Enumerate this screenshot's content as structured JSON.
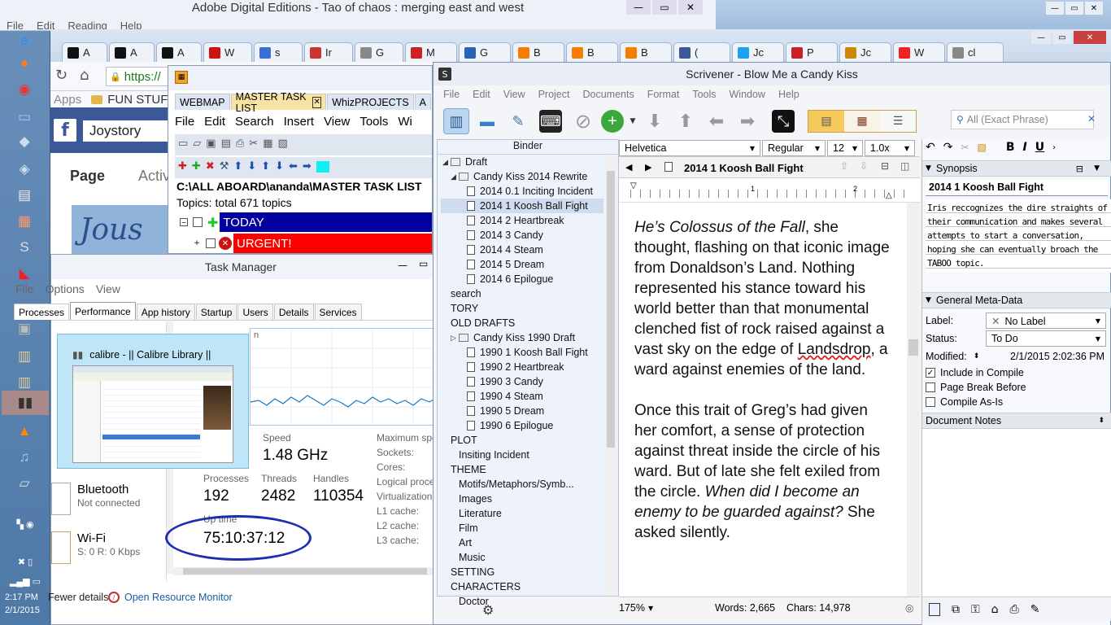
{
  "taskbar": {
    "time": "2:17 PM",
    "date": "2/1/2015"
  },
  "ade": {
    "title": "Adobe Digital Editions - Tao of chaos : merging east and west",
    "menu": [
      "File",
      "Edit",
      "Reading",
      "Help"
    ]
  },
  "chrome": {
    "tabs": [
      {
        "label": "A",
        "icon": "amazon",
        "color": "#111"
      },
      {
        "label": "A",
        "icon": "amazon",
        "color": "#111"
      },
      {
        "label": "A",
        "icon": "amazon",
        "color": "#111"
      },
      {
        "label": "W",
        "icon": "netflix",
        "color": "#c11"
      },
      {
        "label": "s",
        "icon": "google",
        "color": "#3a6fd8"
      },
      {
        "label": "Ir",
        "icon": "gmail",
        "color": "#c33"
      },
      {
        "label": "G",
        "icon": "doc",
        "color": "#888"
      },
      {
        "label": "M",
        "icon": "play",
        "color": "#c22"
      },
      {
        "label": "G",
        "icon": "one",
        "color": "#2a62b8"
      },
      {
        "label": "B",
        "icon": "blogger",
        "color": "#f57d00"
      },
      {
        "label": "B",
        "icon": "blogger",
        "color": "#f57d00"
      },
      {
        "label": "B",
        "icon": "blogger",
        "color": "#f57d00"
      },
      {
        "label": "(",
        "icon": "facebook",
        "color": "#3b5998"
      },
      {
        "label": "Jc",
        "icon": "twitter",
        "color": "#1da1f2"
      },
      {
        "label": "P",
        "icon": "pinterest",
        "color": "#cb2027"
      },
      {
        "label": "Jc",
        "icon": "burger",
        "color": "#c80"
      },
      {
        "label": "W",
        "icon": "youtube",
        "color": "#e22"
      },
      {
        "label": "cl",
        "icon": "doc",
        "color": "#888"
      }
    ],
    "address": "https://",
    "bookmark": "FUN STUFF",
    "apps_label": "Apps"
  },
  "facebook": {
    "search_value": "Joystory",
    "nav_page": "Page",
    "nav_activity": "Activ",
    "banner_text": "Jous"
  },
  "whiz": {
    "tabs": [
      "WEBMAP",
      "MASTER TASK LIST",
      "WhizPROJECTS",
      "A"
    ],
    "menu": [
      "File",
      "Edit",
      "Search",
      "Insert",
      "View",
      "Tools",
      "Wi"
    ],
    "path": "C:\\ALL ABOARD\\ananda\\MASTER TASK LIST",
    "topics": "Topics: total 671 topics",
    "today": "TODAY",
    "urgent": "URGENT!"
  },
  "taskmgr": {
    "title": "Task Manager",
    "menu": [
      "File",
      "Options",
      "View"
    ],
    "tabs": [
      "Processes",
      "Performance",
      "App history",
      "Startup",
      "Users",
      "Details",
      "Services"
    ],
    "speed_label": "Speed",
    "speed": "1.48 GHz",
    "processes_label": "Processes",
    "processes": "192",
    "threads_label": "Threads",
    "threads": "2482",
    "handles_label": "Handles",
    "handles": "110354",
    "uptime_label": "Up time",
    "uptime": "75:10:37:12",
    "right_labels": [
      "Maximum speed:",
      "Sockets:",
      "Cores:",
      "Logical processors:",
      "Virtualization:",
      "L1 cache:",
      "L2 cache:",
      "L3 cache:"
    ],
    "bluetooth": "Bluetooth",
    "bluetooth_status": "Not connected",
    "wifi": "Wi-Fi",
    "wifi_status": "S: 0 R: 0 Kbps",
    "fewer": "Fewer details",
    "resmon": "Open Resource Monitor",
    "graph_label": "n"
  },
  "calibre": {
    "title": "calibre - || Calibre Library ||"
  },
  "scrivener": {
    "title": "Scrivener - Blow Me a Candy Kiss",
    "menu": [
      "File",
      "Edit",
      "View",
      "Project",
      "Documents",
      "Format",
      "Tools",
      "Window",
      "Help"
    ],
    "search_placeholder": "All (Exact Phrase)",
    "binder_label": "Binder",
    "binder": [
      {
        "label": "Draft",
        "level": 0,
        "type": "folder",
        "open": true
      },
      {
        "label": "Candy Kiss 2014 Rewrite",
        "level": 1,
        "type": "folder",
        "open": true
      },
      {
        "label": "2014 0.1 Inciting Incident",
        "level": 2,
        "type": "doc"
      },
      {
        "label": "2014 1 Koosh Ball Fight",
        "level": 2,
        "type": "doc",
        "selected": true
      },
      {
        "label": "2014 2 Heartbreak",
        "level": 2,
        "type": "doc"
      },
      {
        "label": "2014 3 Candy",
        "level": 2,
        "type": "doc"
      },
      {
        "label": "2014 4 Steam",
        "level": 2,
        "type": "doc"
      },
      {
        "label": "2014 5 Dream",
        "level": 2,
        "type": "doc"
      },
      {
        "label": "2014 6 Epilogue",
        "level": 2,
        "type": "doc"
      },
      {
        "label": "search",
        "level": 0,
        "type": "plain"
      },
      {
        "label": "TORY",
        "level": 0,
        "type": "plain"
      },
      {
        "label": "OLD DRAFTS",
        "level": 0,
        "type": "plain"
      },
      {
        "label": "Candy Kiss 1990 Draft",
        "level": 1,
        "type": "folder"
      },
      {
        "label": "1990 1 Koosh Ball Fight",
        "level": 2,
        "type": "doc"
      },
      {
        "label": "1990 2 Heartbreak",
        "level": 2,
        "type": "doc"
      },
      {
        "label": "1990 3 Candy",
        "level": 2,
        "type": "doc"
      },
      {
        "label": "1990 4 Steam",
        "level": 2,
        "type": "doc"
      },
      {
        "label": "1990 5 Dream",
        "level": 2,
        "type": "doc"
      },
      {
        "label": "1990 6 Epilogue",
        "level": 2,
        "type": "doc"
      },
      {
        "label": "PLOT",
        "level": 0,
        "type": "plain"
      },
      {
        "label": "Insiting Incident",
        "level": 1,
        "type": "plain"
      },
      {
        "label": "THEME",
        "level": 0,
        "type": "plain"
      },
      {
        "label": "Motifs/Metaphors/Symb...",
        "level": 1,
        "type": "plain"
      },
      {
        "label": "Images",
        "level": 1,
        "type": "plain"
      },
      {
        "label": "Literature",
        "level": 1,
        "type": "plain"
      },
      {
        "label": "Film",
        "level": 1,
        "type": "plain"
      },
      {
        "label": "Art",
        "level": 1,
        "type": "plain"
      },
      {
        "label": "Music",
        "level": 1,
        "type": "plain"
      },
      {
        "label": "SETTING",
        "level": 0,
        "type": "plain"
      },
      {
        "label": "CHARACTERS",
        "level": 0,
        "type": "plain"
      },
      {
        "label": "Doctor",
        "level": 1,
        "type": "plain"
      }
    ],
    "format": {
      "font": "Helvetica",
      "style": "Regular",
      "size": "12",
      "spacing": "1.0x"
    },
    "doc_title": "2014 1 Koosh Ball Fight",
    "text": {
      "p1_italic": "He’s Colossus of the Fall",
      "p1_rest": ", she thought, flashing on that iconic image from Donaldson’s Land. Nothing represented his stance toward his world better than that monumental clenched fist of rock raised against a vast sky on the edge of ",
      "p1_word": "Landsdrop",
      "p1_end": ", a ward against enemies of the land.",
      "p2": "Once this trait of Greg’s had given her comfort, a sense of protection against threat inside the circle of his ward. But of late she felt exiled from the circle. ",
      "p2_italic": "When did I become an enemy to be guarded against?",
      "p2_end": " She asked silently."
    },
    "ruler_marks": [
      "1",
      "2"
    ],
    "zoom": "175%",
    "words": "Words: 2,665",
    "chars": "Chars: 14,978",
    "inspector": {
      "synopsis_label": "Synopsis",
      "synopsis_title": "2014 1 Koosh Ball Fight",
      "synopsis": "Iris reccognizes the dire straights of their communication and makes several attempts to start a conversation, hoping she can eventually broach the TABOO topic.",
      "meta_label": "General Meta-Data",
      "label_label": "Label:",
      "label_value": "No Label",
      "status_label": "Status:",
      "status_value": "To Do",
      "modified_label": "Modified:",
      "modified_value": "2/1/2015 2:02:36 PM",
      "include": "Include in Compile",
      "pagebreak": "Page Break Before",
      "asis": "Compile As-Is",
      "notes_label": "Document Notes"
    }
  }
}
